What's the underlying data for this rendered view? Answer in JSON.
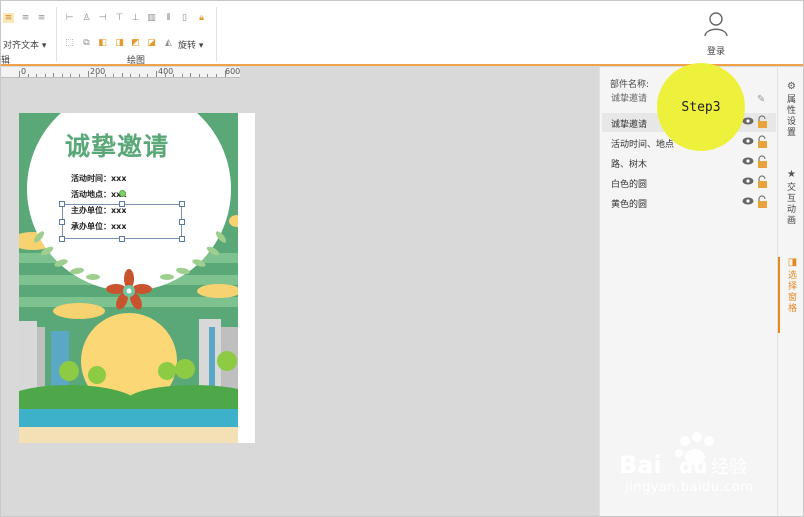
{
  "toolbar": {
    "align_text_label": "对齐文本",
    "draw_group_label": "绘图",
    "rotate_label": "旋转",
    "left_group_label_fragment": "辑",
    "login_label": "登录"
  },
  "ruler": {
    "marks": [
      "0",
      "200",
      "400",
      "600"
    ]
  },
  "poster": {
    "title": "诚挚邀请",
    "info_lines": [
      "活动时间：xxx",
      "活动地点：xxx",
      "主办单位：xxx",
      "承办单位：xxx"
    ]
  },
  "layers_panel": {
    "name_label": "部件名称:",
    "name_value": "诚挚邀请",
    "layers": [
      {
        "name": "诚挚邀请",
        "selected": true
      },
      {
        "name": "活动时间、地点",
        "selected": false
      },
      {
        "name": "路、树木",
        "selected": false
      },
      {
        "name": "白色的圆",
        "selected": false
      },
      {
        "name": "黄色的圆",
        "selected": false
      }
    ]
  },
  "overlay": {
    "step_label": "Step3"
  },
  "side_tabs": [
    {
      "label": "属性设置",
      "icon": "gear-icon",
      "active": false
    },
    {
      "label": "交互动画",
      "icon": "star-icon",
      "active": false
    },
    {
      "label": "选择窗格",
      "icon": "layers-icon",
      "active": true
    }
  ],
  "watermark": {
    "brand": "Bai du 经验",
    "url": "jingyan.baidu.com"
  },
  "colors": {
    "accent": "#f0a24a",
    "poster_green": "#5aa878",
    "step_yellow": "#eef13b",
    "lock_orange": "#e8a33d"
  }
}
